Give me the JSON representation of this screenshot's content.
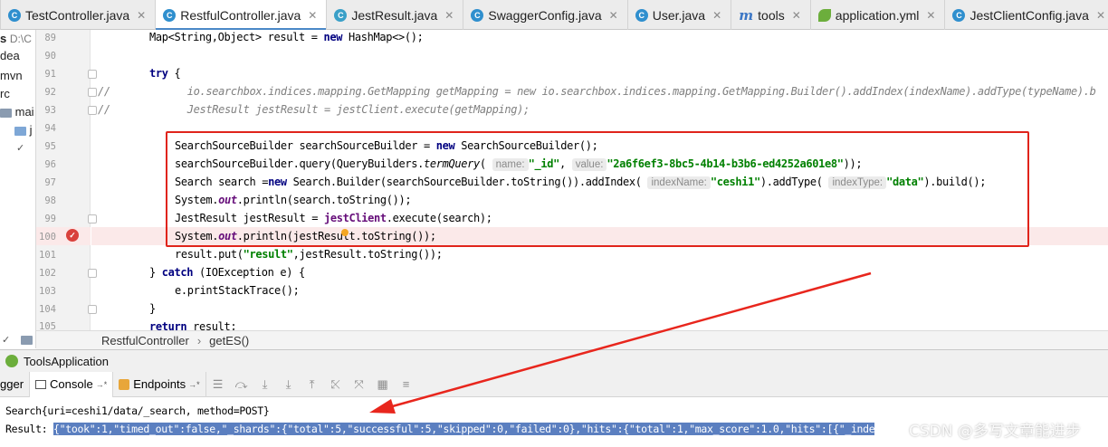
{
  "tabs": [
    {
      "label": "TestController.java",
      "icon": "java-class-icon",
      "active": false
    },
    {
      "label": "RestfulController.java",
      "icon": "java-class-icon",
      "active": true
    },
    {
      "label": "JestResult.java",
      "icon": "java-class-icon",
      "active": false
    },
    {
      "label": "SwaggerConfig.java",
      "icon": "java-class-icon",
      "active": false
    },
    {
      "label": "User.java",
      "icon": "java-class-icon",
      "active": false
    },
    {
      "label": "tools",
      "icon": "maven-icon",
      "active": false
    },
    {
      "label": "application.yml",
      "icon": "spring-leaf-icon",
      "active": false
    },
    {
      "label": "JestClientConfig.java",
      "icon": "java-class-icon",
      "active": false
    }
  ],
  "sidebar": {
    "rows": [
      "s",
      "D:\\C",
      "dea",
      "mvn",
      "rc",
      "mai",
      "j",
      "",
      ""
    ]
  },
  "editor": {
    "line_numbers": [
      "89",
      "90",
      "91",
      "92",
      "93",
      "94",
      "95",
      "96",
      "97",
      "98",
      "99",
      "100",
      "101",
      "102",
      "103",
      "104",
      "105"
    ],
    "comment_mark": "//",
    "lines": {
      "l89": "Map<String,Object> result = ",
      "l89_new": "new",
      "l89_tail": " HashMap<>();",
      "l91_try": "try",
      "l91_tail": " {",
      "l92": "io.searchbox.indices.mapping.GetMapping getMapping = new io.searchbox.indices.mapping.GetMapping.Builder().addIndex(indexName).addType(typeName).b",
      "l93": "JestResult jestResult = jestClient.execute(getMapping);",
      "l95_a": "SearchSourceBuilder searchSourceBuilder = ",
      "l95_new": "new",
      "l95_b": " SearchSourceBuilder();",
      "l96_a": "searchSourceBuilder.query(QueryBuilders.",
      "l96_term": "termQuery",
      "l96_b": "(",
      "l96_hint1": "name:",
      "l96_str1": "\"_id\"",
      "l96_c": ", ",
      "l96_hint2": "value:",
      "l96_str2": "\"2a6f6ef3-8bc5-4b14-b3b6-ed4252a601e8\"",
      "l96_d": "));",
      "l97_a": "Search search =",
      "l97_new": "new",
      "l97_b": " Search.Builder(searchSourceBuilder.toString()).addIndex(",
      "l97_hint1": "indexName:",
      "l97_str1": "\"ceshi1\"",
      "l97_c": ").addType(",
      "l97_hint2": "indexType:",
      "l97_str2": "\"data\"",
      "l97_d": ").build();",
      "l98_a": "System.",
      "l98_out": "out",
      "l98_b": ".println(search.toString());",
      "l99_a": "JestResult jestResult = ",
      "l99_fld": "jestClient",
      "l99_b": ".execute(search);",
      "l100_a": "System.",
      "l100_out": "out",
      "l100_b": ".println(jestResult.toString());",
      "l101_a": "result.put(",
      "l101_str": "\"result\"",
      "l101_b": ",jestResult.toString());",
      "l102_a": "} ",
      "l102_catch": "catch",
      "l102_b": " (IOException e) {",
      "l103": "e.printStackTrace();",
      "l104": "}",
      "l105_ret": "return",
      "l105_b": " result;"
    }
  },
  "breadcrumb": {
    "class": "RestfulController",
    "separator": "›",
    "method": "getES()"
  },
  "run_panel": {
    "title": "ToolsApplication",
    "tabs": {
      "left": "gger",
      "console": "Console",
      "console_suffix": "→*",
      "endpoints": "Endpoints",
      "endpoints_suffix": "→*"
    },
    "console": {
      "line1": "Search{uri=ceshi1/data/_search, method=POST}",
      "line2_prefix": "Result: ",
      "line2_selected": "{\"took\":1,\"timed_out\":false,\"_shards\":{\"total\":5,\"successful\":5,\"skipped\":0,\"failed\":0},\"hits\":{\"total\":1,\"max_score\":1.0,\"hits\":[{\"_inde"
    }
  },
  "watermark": "CSDN @多写文章能进步",
  "colors": {
    "annotation_red": "#e0241b",
    "active_tab_underline": "#4a88c7",
    "keyword": "#000080",
    "string": "#008000",
    "field": "#660e7a",
    "console_selection": "#5b7fc0",
    "breakpoint_line": "#fbe9e9"
  }
}
